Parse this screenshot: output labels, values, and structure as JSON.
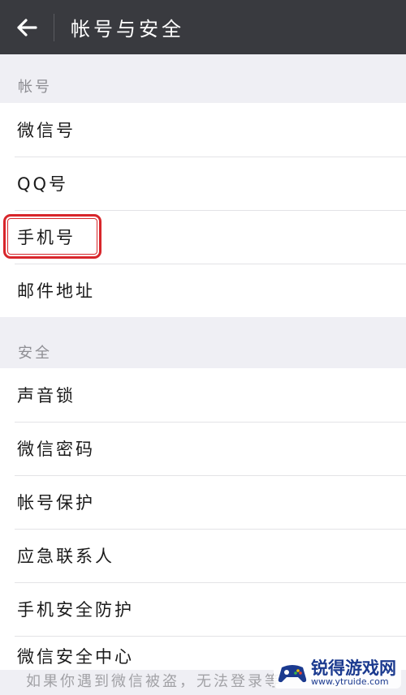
{
  "header": {
    "title": "帐号与安全",
    "back_icon": "arrow-left-icon",
    "background": "#393a3f"
  },
  "account_section": {
    "header": "帐号",
    "items": [
      {
        "label": "微信号"
      },
      {
        "label": "QQ号"
      },
      {
        "label": "手机号"
      },
      {
        "label": "邮件地址"
      }
    ]
  },
  "security_section": {
    "header": "安全",
    "items": [
      {
        "label": "声音锁"
      },
      {
        "label": "微信密码"
      },
      {
        "label": "帐号保护"
      },
      {
        "label": "应急联系人"
      },
      {
        "label": "手机安全防护"
      },
      {
        "label": "微信安全中心"
      }
    ]
  },
  "footer_tip": "如果你遇到微信被盗，无法登录等",
  "highlight_color": "#d8262b",
  "watermark": {
    "name": "锐得游戏网",
    "url": "www.ytruide.com",
    "icon": "gamepad-logo-icon"
  }
}
